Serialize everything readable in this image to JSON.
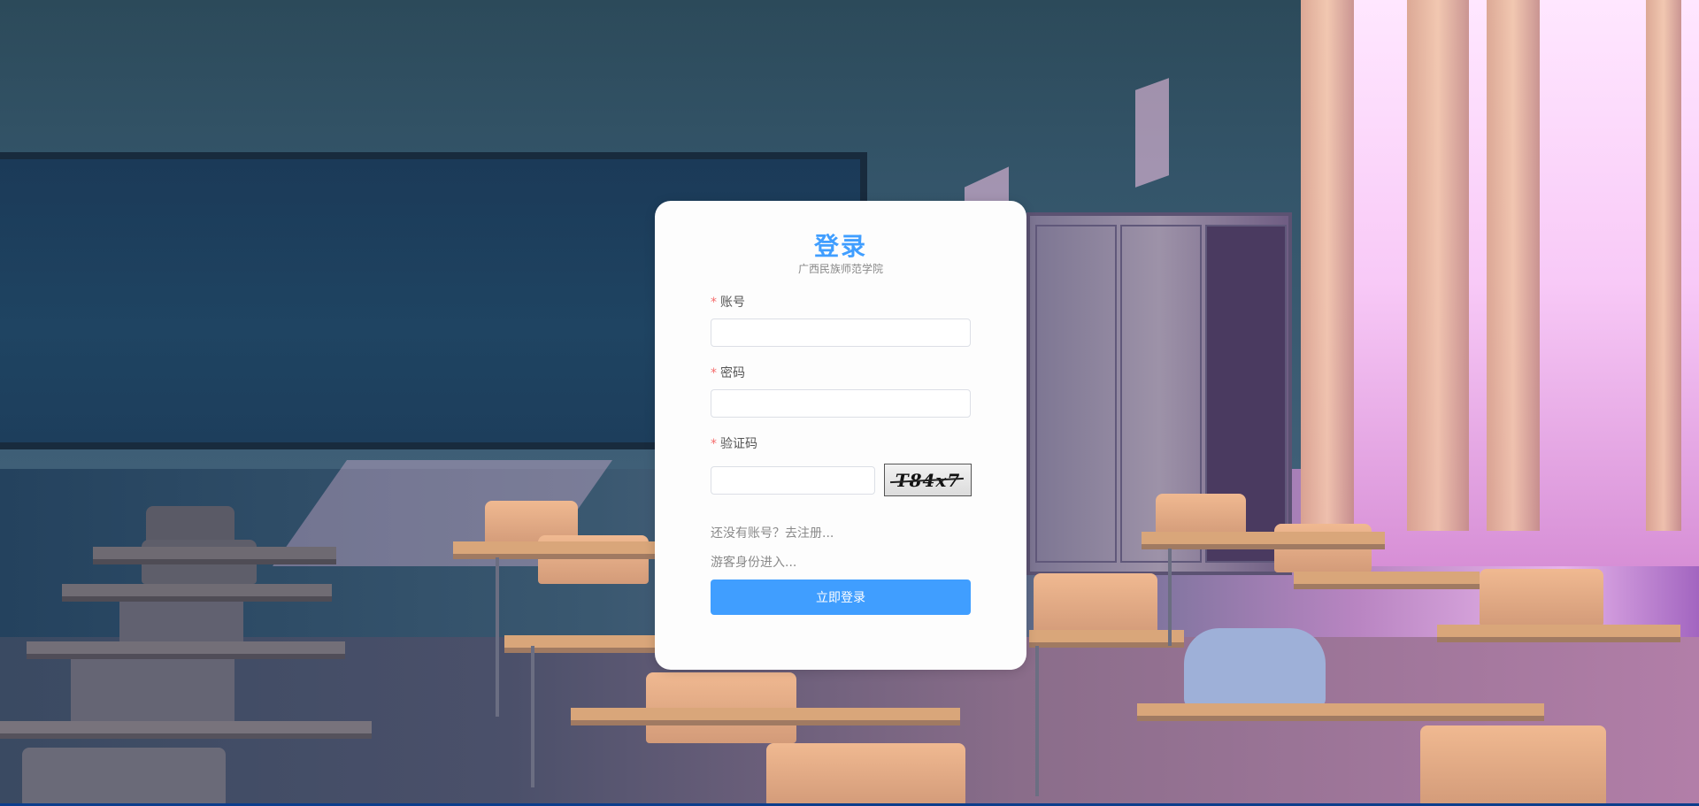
{
  "login": {
    "title": "登录",
    "subtitle": "广西民族师范学院",
    "required_mark": "*",
    "account_label": "账号",
    "account_value": "",
    "password_label": "密码",
    "password_value": "",
    "captcha_label": "验证码",
    "captcha_value": "",
    "captcha_text": "T84x7",
    "register_link": "还没有账号？去注册...",
    "guest_link": "游客身份进入...",
    "submit_label": "立即登录"
  },
  "colors": {
    "accent": "#409eff",
    "required": "#f56c6c",
    "link": "#8a8a8a"
  }
}
